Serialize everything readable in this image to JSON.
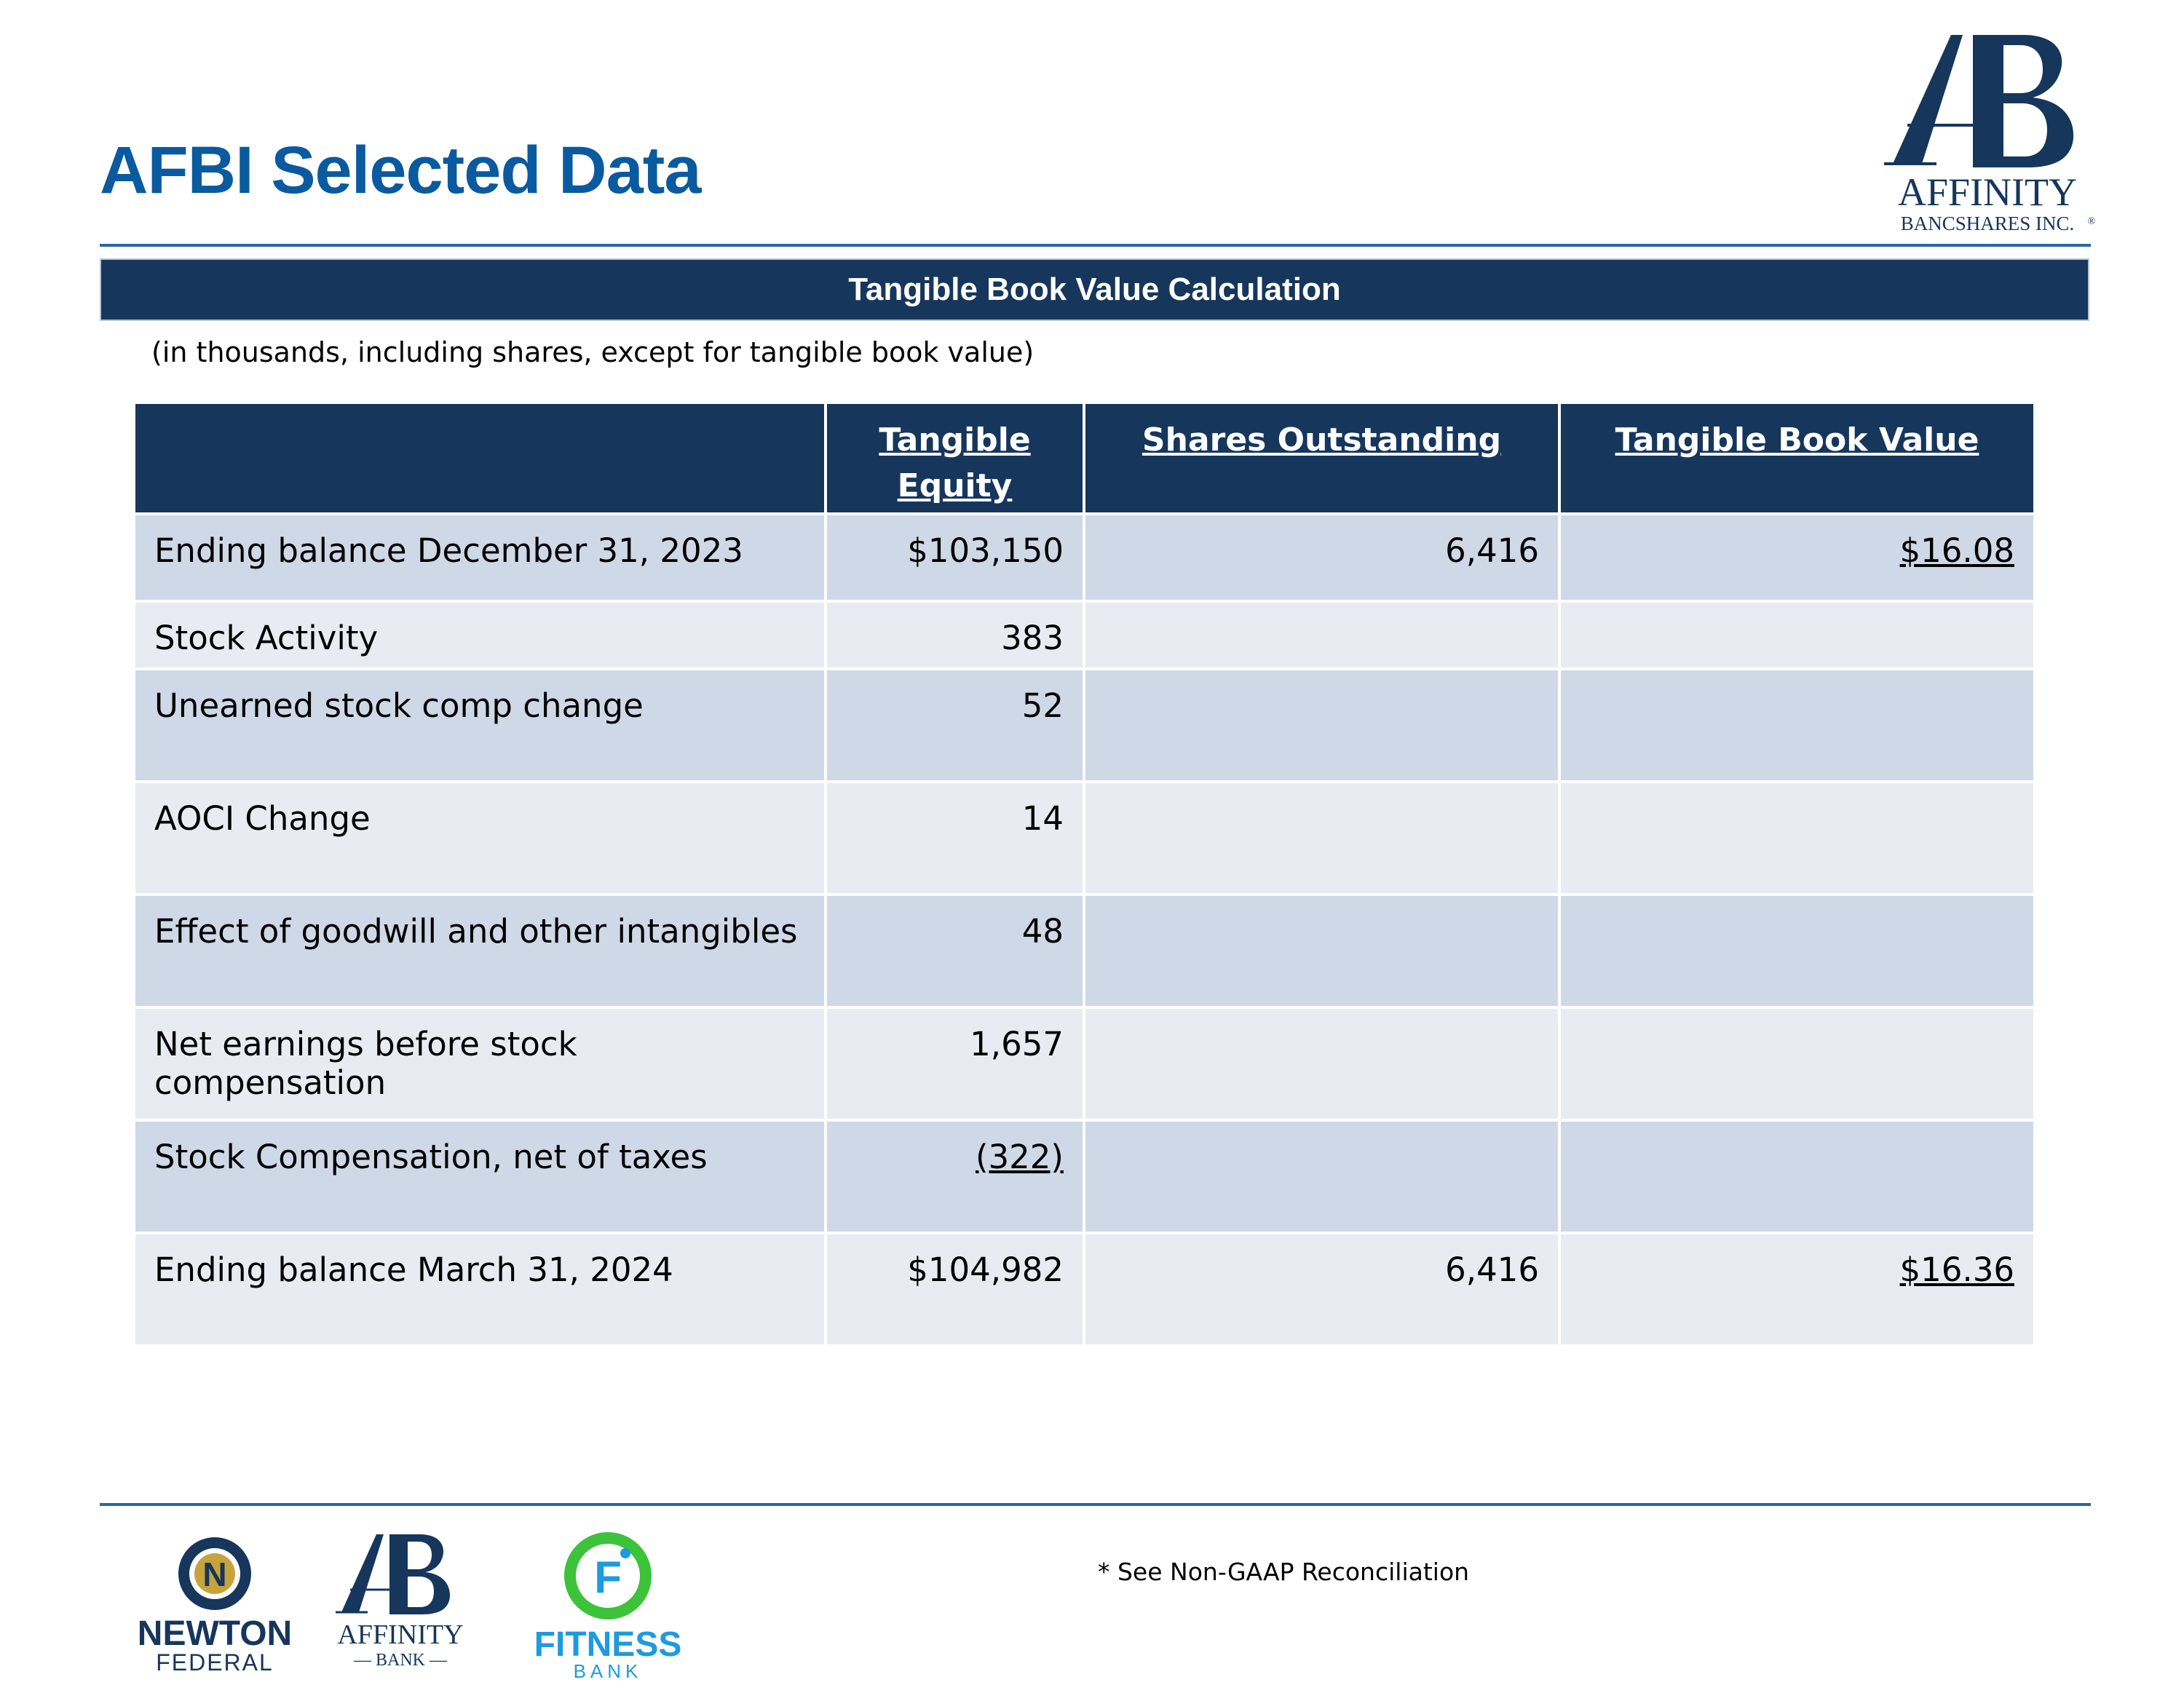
{
  "header": {
    "title": "AFBI Selected Data",
    "logo": {
      "monogram": "AB",
      "name": "AFFINITY",
      "sub": "BANCSHARES INC.",
      "mark": "®"
    }
  },
  "banner": {
    "title": "Tangible Book Value Calculation"
  },
  "note": "(in thousands, including shares, except for tangible book value)",
  "table": {
    "headers": [
      "",
      "Tangible Equity",
      "Shares Outstanding",
      "Tangible Book Value"
    ],
    "rows": [
      {
        "label": "Ending balance December 31, 2023",
        "equity": "$103,150",
        "shares": "6,416",
        "tbv": "$16.08"
      },
      {
        "label": "Stock Activity",
        "equity": "383",
        "shares": "",
        "tbv": ""
      },
      {
        "label": "Unearned stock comp change",
        "equity": "52",
        "shares": "",
        "tbv": ""
      },
      {
        "label": "AOCI Change",
        "equity": "14",
        "shares": "",
        "tbv": ""
      },
      {
        "label": "Effect of goodwill and other intangibles",
        "equity": "48",
        "shares": "",
        "tbv": ""
      },
      {
        "label": "Net earnings before stock compensation",
        "equity": "1,657",
        "shares": "",
        "tbv": ""
      },
      {
        "label": "Stock Compensation, net of taxes",
        "equity": "(322)",
        "shares": "",
        "tbv": ""
      },
      {
        "label": "Ending balance March 31, 2024",
        "equity": "$104,982",
        "shares": "6,416",
        "tbv": "$16.36"
      }
    ]
  },
  "footer": {
    "note": "* See Non-GAAP Reconciliation",
    "logos": [
      {
        "name": "NEWTON",
        "sub": "FEDERAL",
        "mark": "N"
      },
      {
        "name": "AFFINITY",
        "sub": "— BANK —",
        "mark": "AB"
      },
      {
        "name": "FITNESS",
        "sub": "BANK",
        "mark": "F"
      }
    ]
  },
  "colors": {
    "title": "#0a5aa0",
    "navy": "#16365c",
    "row_dark": "#cfd8e6",
    "row_light": "#e8ecf2",
    "fitness_green": "#3cc33a",
    "fitness_blue": "#1d9be0",
    "newton_gold": "#c8a33c"
  }
}
